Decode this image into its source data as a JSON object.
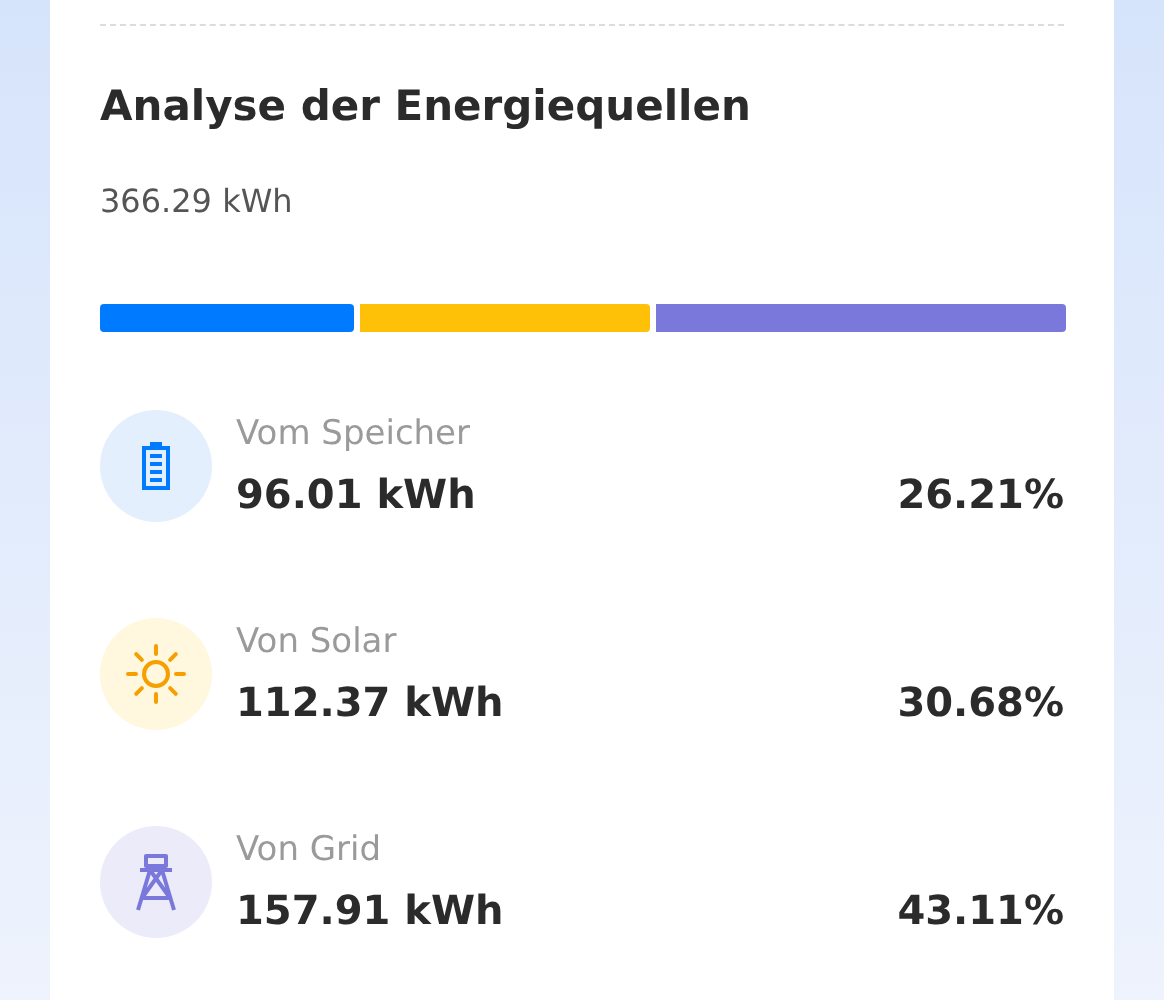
{
  "title": "Analyse der Energiequellen",
  "total": "366.29 kWh",
  "sources": [
    {
      "kind": "battery",
      "label": "Vom Speicher",
      "value": "96.01 kWh",
      "percent": "26.21%",
      "color": "#007bff"
    },
    {
      "kind": "sun",
      "label": "Von Solar",
      "value": "112.37 kWh",
      "percent": "30.68%",
      "color": "#ffc107"
    },
    {
      "kind": "tower",
      "label": "Von Grid",
      "value": "157.91 kWh",
      "percent": "43.11%",
      "color": "#7b78dc"
    }
  ]
}
